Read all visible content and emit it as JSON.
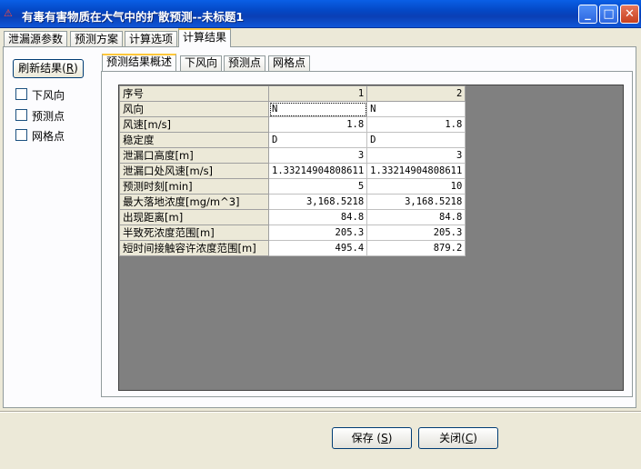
{
  "window": {
    "title": "有毒有害物质在大气中的扩散预测--未标题1",
    "icon": "app-icon",
    "controls": [
      "minimize-icon",
      "maximize-icon",
      "close-icon"
    ]
  },
  "tabs": [
    "泄漏源参数",
    "预测方案",
    "计算选项",
    "计算结果"
  ],
  "active_tab": "计算结果",
  "left": {
    "refresh_label": "刷新结果",
    "refresh_shortcut": "R",
    "checkboxes": [
      {
        "label": "下风向",
        "checked": false
      },
      {
        "label": "预测点",
        "checked": false
      },
      {
        "label": "网格点",
        "checked": false
      }
    ]
  },
  "inner_tabs": [
    "预测结果概述",
    "下风向",
    "预测点",
    "网格点"
  ],
  "active_inner_tab": "预测结果概述",
  "grid": {
    "header": [
      "序号",
      "1",
      "2"
    ],
    "rows": [
      [
        "风向",
        "N",
        "N"
      ],
      [
        "风速[m/s]",
        "1.8",
        "1.8"
      ],
      [
        "稳定度",
        "D",
        "D"
      ],
      [
        "泄漏口高度[m]",
        "3",
        "3"
      ],
      [
        "泄漏口处风速[m/s]",
        "1.33214904808611",
        "1.33214904808611"
      ],
      [
        "预测时刻[min]",
        "5",
        "10"
      ],
      [
        "最大落地浓度[mg/m^3]",
        "3,168.5218",
        "3,168.5218"
      ],
      [
        "出现距离[m]",
        "84.8",
        "84.8"
      ],
      [
        "半致死浓度范围[m]",
        "205.3",
        "205.3"
      ],
      [
        "短时间接触容许浓度范围[m]",
        "495.4",
        "879.2"
      ]
    ]
  },
  "footer": {
    "save_label": "保存",
    "save_shortcut": "S",
    "close_label": "关闭",
    "close_shortcut": "C"
  }
}
